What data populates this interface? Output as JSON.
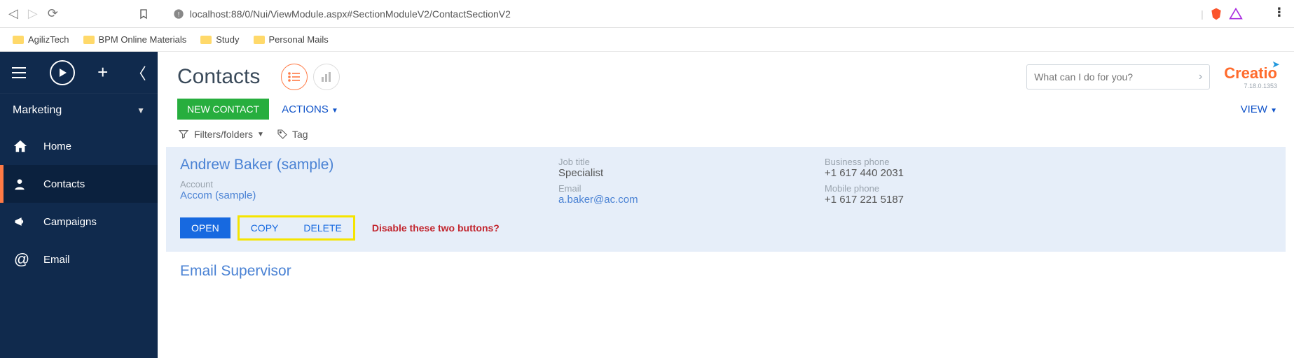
{
  "browser": {
    "url": "localhost:88/0/Nui/ViewModule.aspx#SectionModuleV2/ContactSectionV2"
  },
  "bookmarks": [
    "AgilizTech",
    "BPM Online Materials",
    "Study",
    "Personal Mails"
  ],
  "workspace": "Marketing",
  "nav": [
    {
      "label": "Home",
      "icon": "home"
    },
    {
      "label": "Contacts",
      "icon": "person"
    },
    {
      "label": "Campaigns",
      "icon": "megaphone"
    },
    {
      "label": "Email",
      "icon": "at"
    }
  ],
  "page": {
    "title": "Contacts",
    "search_placeholder": "What can I do for you?",
    "brand": "Creatio",
    "version": "7.18.0.1353",
    "new_btn": "NEW CONTACT",
    "actions": "ACTIONS",
    "view": "VIEW",
    "filters_label": "Filters/folders",
    "tag_label": "Tag"
  },
  "records": [
    {
      "name": "Andrew Baker (sample)",
      "account_label": "Account",
      "account": "Accom (sample)",
      "jobtitle_label": "Job title",
      "jobtitle": "Specialist",
      "email_label": "Email",
      "email": "a.baker@ac.com",
      "bphone_label": "Business phone",
      "bphone": "+1 617 440 2031",
      "mphone_label": "Mobile phone",
      "mphone": "+1 617 221 5187",
      "open": "OPEN",
      "copy": "COPY",
      "delete": "DELETE",
      "annotation": "Disable these two buttons?"
    },
    {
      "name": "Email Supervisor"
    }
  ]
}
